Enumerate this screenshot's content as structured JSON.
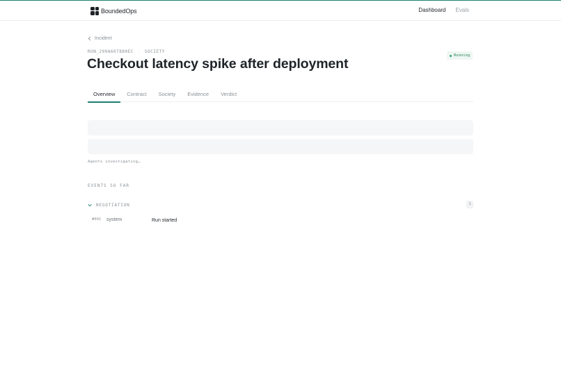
{
  "app": {
    "brand": "BoundedOps"
  },
  "nav": {
    "items": [
      {
        "label": "Dashboard"
      },
      {
        "label": "Evals"
      }
    ]
  },
  "breadcrumb": {
    "back_label": "Incident"
  },
  "run": {
    "id": "RUN_299A607880EC",
    "mode": "SOCIETY"
  },
  "page": {
    "title": "Checkout latency spike after deployment"
  },
  "status_badge": {
    "label": "Running",
    "color": "#2e9e6b"
  },
  "tabs": [
    {
      "label": "Overview",
      "active": true
    },
    {
      "label": "Contract"
    },
    {
      "label": "Society"
    },
    {
      "label": "Evidence"
    },
    {
      "label": "Verdict"
    }
  ],
  "loading": {
    "status_text": "Agents investigating…"
  },
  "events": {
    "section_title": "EVENTS SO FAR",
    "groups": [
      {
        "name": "NEGOTIATION",
        "count": "1",
        "items": [
          {
            "number": "#001",
            "actor": "system",
            "message": "Run started"
          }
        ]
      }
    ]
  },
  "colors": {
    "accent": "#1b7f72"
  }
}
